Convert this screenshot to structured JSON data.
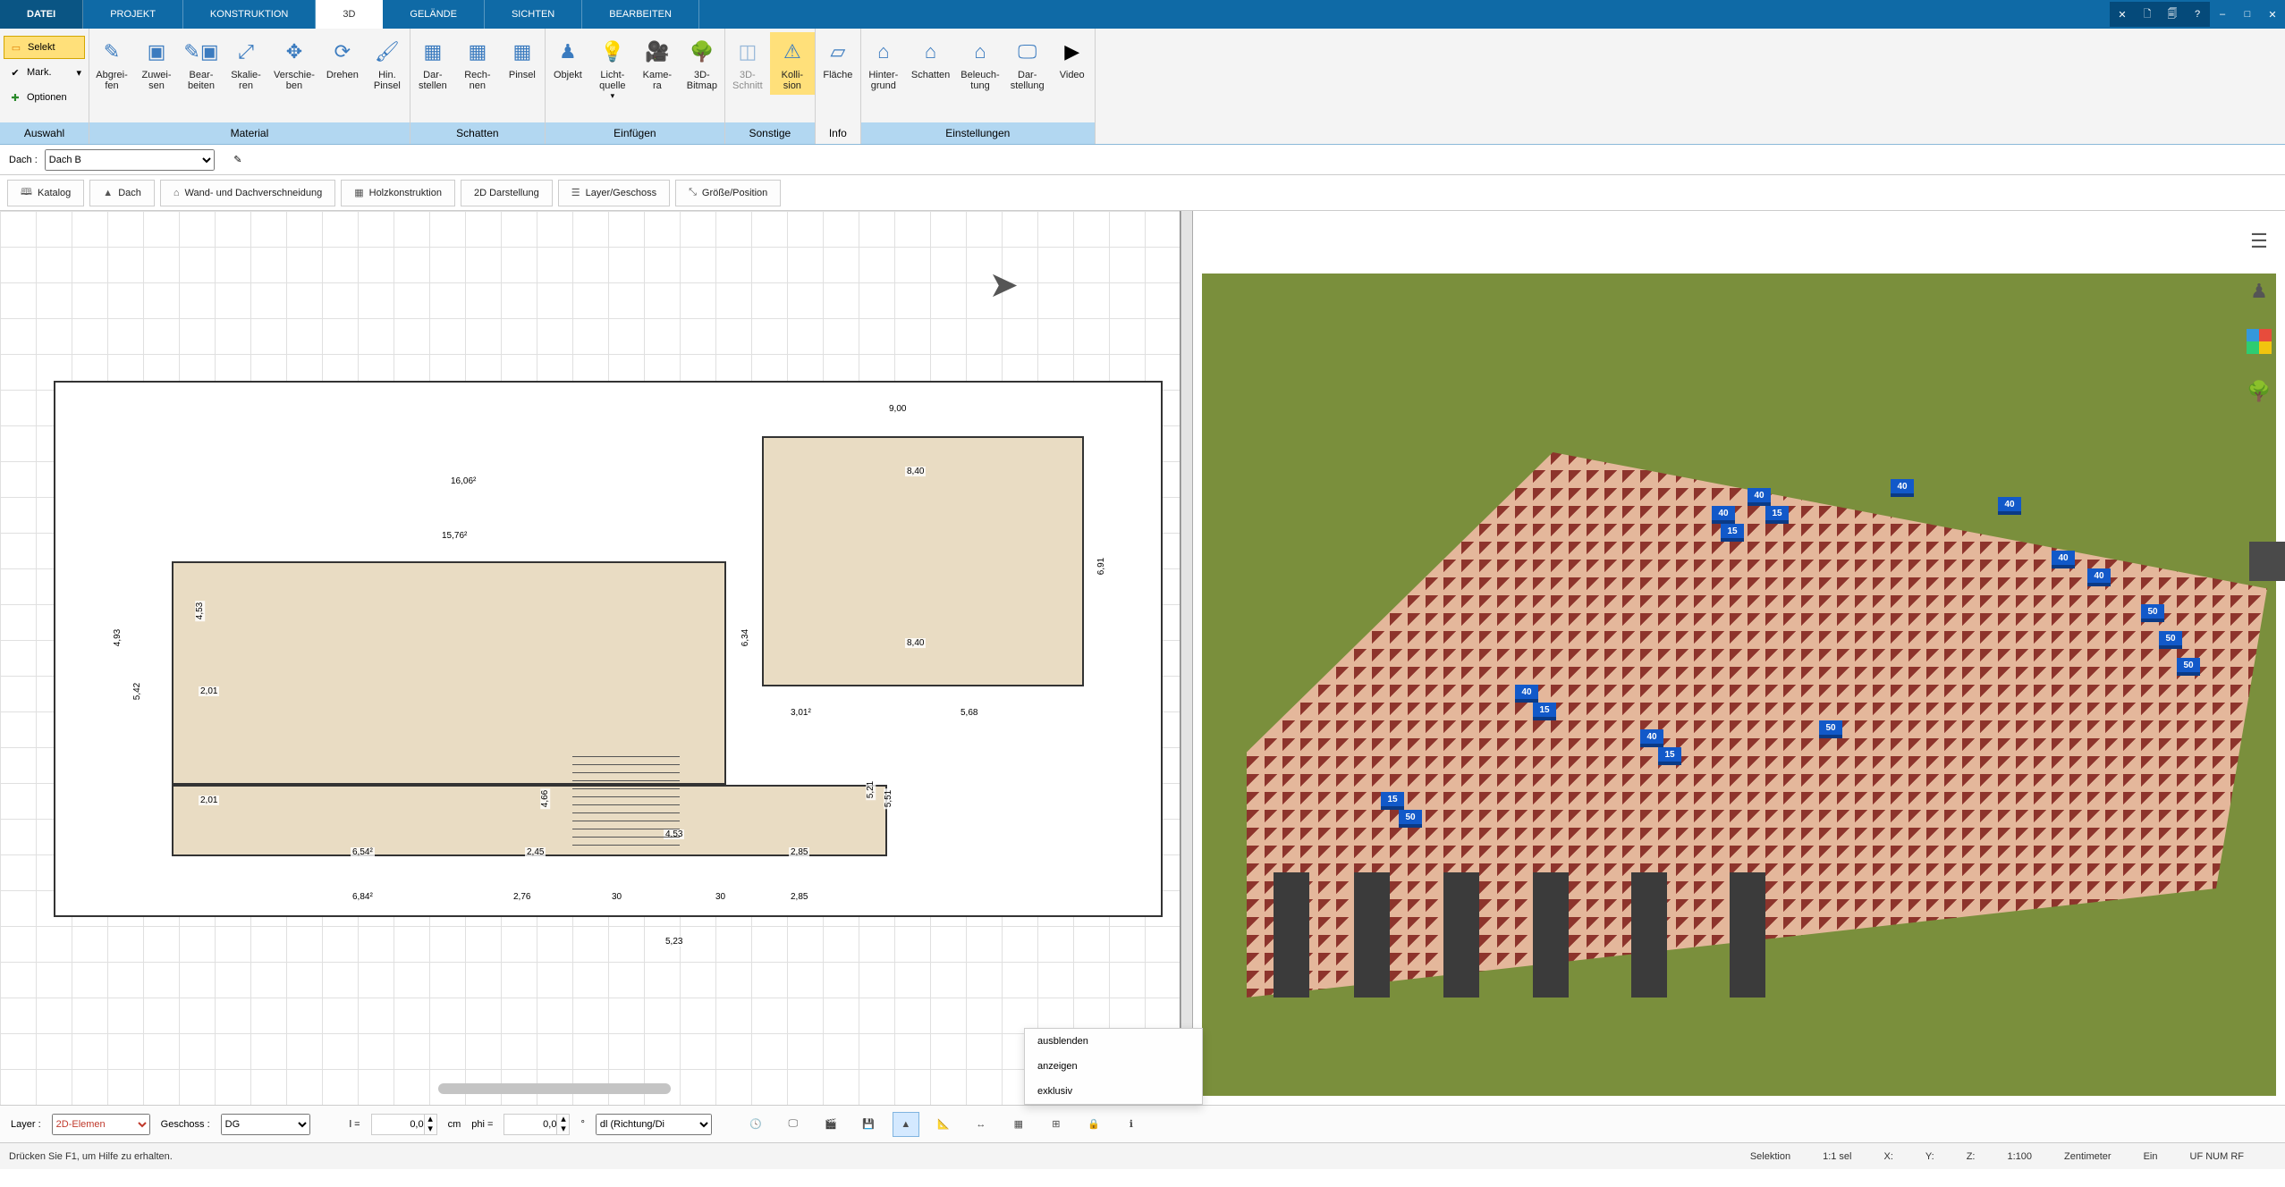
{
  "menu": {
    "tabs": [
      "DATEI",
      "PROJEKT",
      "KONSTRUKTION",
      "3D",
      "GELÄNDE",
      "SICHTEN",
      "BEARBEITEN"
    ],
    "active": 3
  },
  "selgroup": {
    "selekt": "Selekt",
    "mark": "Mark.",
    "optionen": "Optionen",
    "label": "Auswahl"
  },
  "ribbon": {
    "material": {
      "label": "Material",
      "items": [
        "Abgrei-\nfen",
        "Zuwei-\nsen",
        "Bear-\nbeiten",
        "Skalie-\nren",
        "Verschie-\nben",
        "Drehen",
        "Hin.\nPinsel"
      ]
    },
    "schatten": {
      "label": "Schatten",
      "items": [
        "Dar-\nstellen",
        "Rech-\nnen",
        "Pinsel"
      ]
    },
    "einfuegen": {
      "label": "Einfügen",
      "items": [
        "Objekt",
        "Licht-\nquelle",
        "Kame-\nra",
        "3D-\nBitmap"
      ]
    },
    "sonstige": {
      "label": "Sonstige",
      "items": [
        "3D-\nSchnitt",
        "Kolli-\nsion"
      ]
    },
    "info": {
      "label": "Info",
      "items": [
        "Fläche"
      ]
    },
    "einstellungen": {
      "label": "Einstellungen",
      "items": [
        "Hinter-\ngrund",
        "Schatten",
        "Beleuch-\ntung",
        "Dar-\nstellung",
        "Video"
      ]
    }
  },
  "dachbar": {
    "label": "Dach :",
    "value": "Dach B"
  },
  "subtabs": [
    "Katalog",
    "Dach",
    "Wand- und Dachverschneidung",
    "Holzkonstruktion",
    "2D Darstellung",
    "Layer/Geschoss",
    "Größe/Position"
  ],
  "dims": {
    "a": "9,00",
    "b": "16,06²",
    "c": "5,42",
    "d": "4,93",
    "e": "15,76²",
    "f": "4,53",
    "g": "2,01",
    "h": "8,40",
    "i": "6,84²",
    "j": "6,54²",
    "k": "4,66",
    "l": "2,45",
    "m": "2,85",
    "n": "5,23",
    "o": "6,34",
    "p": "5,68",
    "q": "6,91",
    "r": "5,21",
    "s": "5,51",
    "t": "2,76",
    "u": "3,01²",
    "v": "4,53",
    "w": "30",
    "x": "30",
    "y": "8,40"
  },
  "ctx": [
    "ausblenden",
    "anzeigen",
    "exklusiv"
  ],
  "bottom": {
    "layer_lbl": "Layer :",
    "layer_val": "2D-Elemen",
    "geschoss_lbl": "Geschoss :",
    "geschoss_val": "DG",
    "l_lbl": "l =",
    "l_val": "0,0",
    "l_unit": "cm",
    "phi_lbl": "phi =",
    "phi_val": "0,0",
    "phi_unit": "°",
    "mode": "dl (Richtung/Di"
  },
  "status": {
    "help": "Drücken Sie F1, um Hilfe zu erhalten.",
    "sel": "Selektion",
    "ratio": "1:1 sel",
    "x": "X:",
    "y": "Y:",
    "z": "Z:",
    "scale": "1:100",
    "unit": "Zentimeter",
    "ein": "Ein",
    "caps": "UF NUM RF"
  },
  "tag3d": [
    "40",
    "15",
    "40",
    "15",
    "40",
    "40",
    "40",
    "40",
    "50",
    "50",
    "50",
    "15",
    "50",
    "40",
    "15",
    "40",
    "15",
    "50"
  ]
}
